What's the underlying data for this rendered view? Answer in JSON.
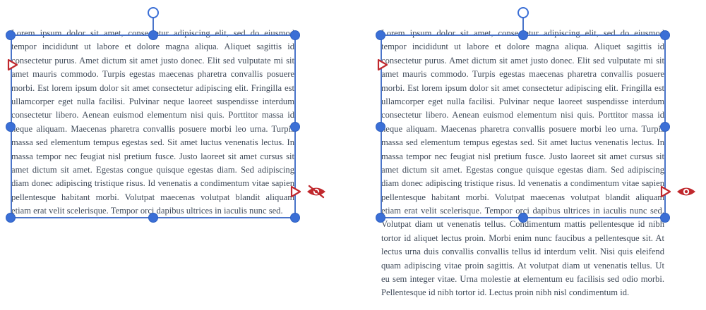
{
  "lines": [
    "Lorem ipsum dolor sit amet, consectetur adipiscing elit, sed do eiusmod",
    "tempor incididunt ut labore et dolore magna aliqua. Aliquet sagittis id",
    "consectetur purus. Amet dictum sit amet justo donec. Elit sed vulputate mi sit",
    "amet mauris commodo. Turpis egestas maecenas pharetra convallis posuere",
    "morbi. Est lorem ipsum dolor sit amet consectetur adipiscing elit. Fringilla est",
    "ullamcorper eget nulla facilisi. Pulvinar neque laoreet suspendisse interdum",
    "consectetur libero. Aenean euismod elementum nisi quis. Porttitor massa id",
    "neque aliquam. Maecenas pharetra convallis posuere morbi leo urna. Turpis",
    "massa sed elementum tempus egestas sed. Sit amet luctus venenatis lectus. In",
    "massa tempor nec feugiat nisl pretium fusce. Justo laoreet sit amet cursus sit",
    "amet dictum sit amet. Egestas congue quisque egestas diam. Sed adipiscing",
    "diam donec adipiscing tristique risus. Id venenatis a condimentum vitae sapien",
    "pellentesque habitant morbi. Volutpat maecenas volutpat blandit aliquam",
    "etiam erat velit scelerisque. Tempor orci dapibus ultrices in iaculis nunc sed.",
    "Volutpat diam ut venenatis tellus. Condimentum mattis pellentesque id nibh",
    "tortor id aliquet lectus proin. Morbi enim nunc faucibus a pellentesque sit. At",
    "lectus urna duis convallis convallis tellus id interdum velit. Nisi quis eleifend",
    "quam adipiscing vitae proin sagittis. At volutpat diam ut venenatis tellus. Ut",
    "eu sem integer vitae. Urna molestie at elementum eu facilisis sed odio morbi.",
    "Pellentesque id nibh tortor id. Lectus proin nibh nisl condimentum id."
  ],
  "frames": [
    {
      "visible_line_count": 14,
      "overflow": "clipped"
    },
    {
      "visible_line_count": 20,
      "overflow": "shown"
    }
  ],
  "colors": {
    "selection": "#3b6fd6",
    "port_and_visibility": "#c0282d",
    "text": "#3f4a59"
  },
  "icons": {
    "rotate": "rotate-handle-icon",
    "in_port": "in-port-icon",
    "out_port": "out-port-icon",
    "visibility": "visibility-eye-icon"
  }
}
